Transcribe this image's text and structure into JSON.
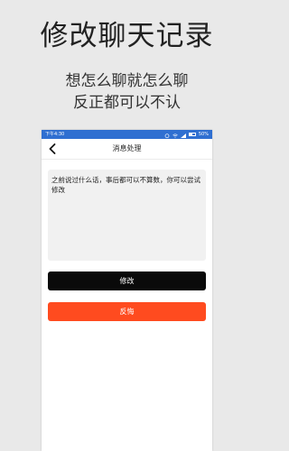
{
  "promo": {
    "title": "修改聊天记录",
    "subtitle_line1": "想怎么聊就怎么聊",
    "subtitle_line2": "反正都可以不认"
  },
  "statusbar": {
    "time": "下午4:30",
    "battery": "50%"
  },
  "navbar": {
    "title": "消息处理"
  },
  "message": {
    "text": "之前说过什么话，事后都可以不算数，你可以尝试修改"
  },
  "buttons": {
    "edit_label": "修改",
    "undo_label": "反悔"
  },
  "colors": {
    "status_bar": "#2f6fd1",
    "edit_button": "#0a0a0a",
    "undo_button": "#ff4b1f"
  }
}
